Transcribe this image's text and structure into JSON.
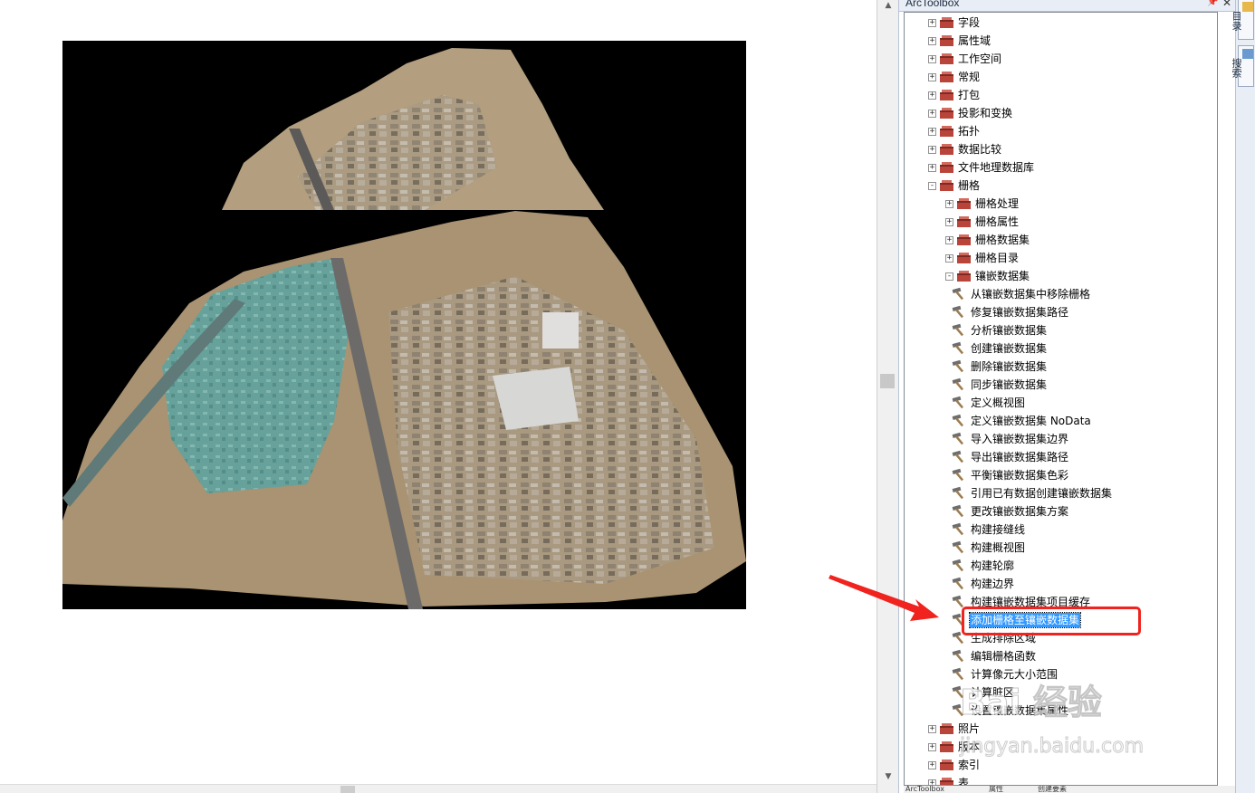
{
  "panel": {
    "title": "ArcToolbox"
  },
  "tree": [
    {
      "level": 0,
      "expander": "+",
      "icon": "toolbox",
      "label": "字段"
    },
    {
      "level": 0,
      "expander": "+",
      "icon": "toolbox",
      "label": "属性域"
    },
    {
      "level": 0,
      "expander": "+",
      "icon": "toolbox",
      "label": "工作空间"
    },
    {
      "level": 0,
      "expander": "+",
      "icon": "toolbox",
      "label": "常规"
    },
    {
      "level": 0,
      "expander": "+",
      "icon": "toolbox",
      "label": "打包"
    },
    {
      "level": 0,
      "expander": "+",
      "icon": "toolbox",
      "label": "投影和变换"
    },
    {
      "level": 0,
      "expander": "+",
      "icon": "toolbox",
      "label": "拓扑"
    },
    {
      "level": 0,
      "expander": "+",
      "icon": "toolbox",
      "label": "数据比较"
    },
    {
      "level": 0,
      "expander": "+",
      "icon": "toolbox",
      "label": "文件地理数据库"
    },
    {
      "level": 0,
      "expander": "-",
      "icon": "toolbox",
      "label": "栅格"
    },
    {
      "level": 1,
      "expander": "+",
      "icon": "toolbox",
      "label": "栅格处理"
    },
    {
      "level": 1,
      "expander": "+",
      "icon": "toolbox",
      "label": "栅格属性"
    },
    {
      "level": 1,
      "expander": "+",
      "icon": "toolbox",
      "label": "栅格数据集"
    },
    {
      "level": 1,
      "expander": "+",
      "icon": "toolbox",
      "label": "栅格目录"
    },
    {
      "level": 1,
      "expander": "-",
      "icon": "toolbox",
      "label": "镶嵌数据集"
    },
    {
      "level": 2,
      "expander": "",
      "icon": "hammer",
      "label": "从镶嵌数据集中移除栅格"
    },
    {
      "level": 2,
      "expander": "",
      "icon": "hammer",
      "label": "修复镶嵌数据集路径"
    },
    {
      "level": 2,
      "expander": "",
      "icon": "hammer",
      "label": "分析镶嵌数据集"
    },
    {
      "level": 2,
      "expander": "",
      "icon": "hammer",
      "label": "创建镶嵌数据集"
    },
    {
      "level": 2,
      "expander": "",
      "icon": "hammer",
      "label": "删除镶嵌数据集"
    },
    {
      "level": 2,
      "expander": "",
      "icon": "hammer",
      "label": "同步镶嵌数据集"
    },
    {
      "level": 2,
      "expander": "",
      "icon": "hammer",
      "label": "定义概视图"
    },
    {
      "level": 2,
      "expander": "",
      "icon": "hammer",
      "label": "定义镶嵌数据集 NoData"
    },
    {
      "level": 2,
      "expander": "",
      "icon": "hammer",
      "label": "导入镶嵌数据集边界"
    },
    {
      "level": 2,
      "expander": "",
      "icon": "hammer",
      "label": "导出镶嵌数据集路径"
    },
    {
      "level": 2,
      "expander": "",
      "icon": "hammer",
      "label": "平衡镶嵌数据集色彩"
    },
    {
      "level": 2,
      "expander": "",
      "icon": "hammer",
      "label": "引用已有数据创建镶嵌数据集"
    },
    {
      "level": 2,
      "expander": "",
      "icon": "hammer",
      "label": "更改镶嵌数据集方案"
    },
    {
      "level": 2,
      "expander": "",
      "icon": "hammer",
      "label": "构建接缝线"
    },
    {
      "level": 2,
      "expander": "",
      "icon": "hammer",
      "label": "构建概视图"
    },
    {
      "level": 2,
      "expander": "",
      "icon": "hammer",
      "label": "构建轮廓"
    },
    {
      "level": 2,
      "expander": "",
      "icon": "hammer",
      "label": "构建边界"
    },
    {
      "level": 2,
      "expander": "",
      "icon": "hammer",
      "label": "构建镶嵌数据集项目缓存"
    },
    {
      "level": 2,
      "expander": "",
      "icon": "hammer",
      "label": "添加栅格至镶嵌数据集",
      "selected": true
    },
    {
      "level": 2,
      "expander": "",
      "icon": "hammer",
      "label": "生成排除区域"
    },
    {
      "level": 2,
      "expander": "",
      "icon": "hammer",
      "label": "编辑栅格函数"
    },
    {
      "level": 2,
      "expander": "",
      "icon": "hammer",
      "label": "计算像元大小范围"
    },
    {
      "level": 2,
      "expander": "",
      "icon": "hammer",
      "label": "计算脏区"
    },
    {
      "level": 2,
      "expander": "",
      "icon": "hammer",
      "label": "设置镶嵌数据集属性"
    },
    {
      "level": 0,
      "expander": "+",
      "icon": "toolbox",
      "label": "照片"
    },
    {
      "level": 0,
      "expander": "+",
      "icon": "toolbox",
      "label": "版本"
    },
    {
      "level": 0,
      "expander": "+",
      "icon": "toolbox",
      "label": "索引"
    },
    {
      "level": 0,
      "expander": "+",
      "icon": "toolbox",
      "label": "表"
    }
  ],
  "bottom_tabs": [
    "ArcToolbox",
    "属性",
    "创建要素"
  ],
  "side_tabs": [
    "目录",
    "搜索"
  ],
  "watermark": {
    "brand": "Bai 经验",
    "url": "jingyan.baidu.com"
  },
  "colors": {
    "selection": "#3399ff",
    "highlight_box": "#f0231e",
    "arrow": "#f0231e",
    "map_background": "#000000"
  }
}
